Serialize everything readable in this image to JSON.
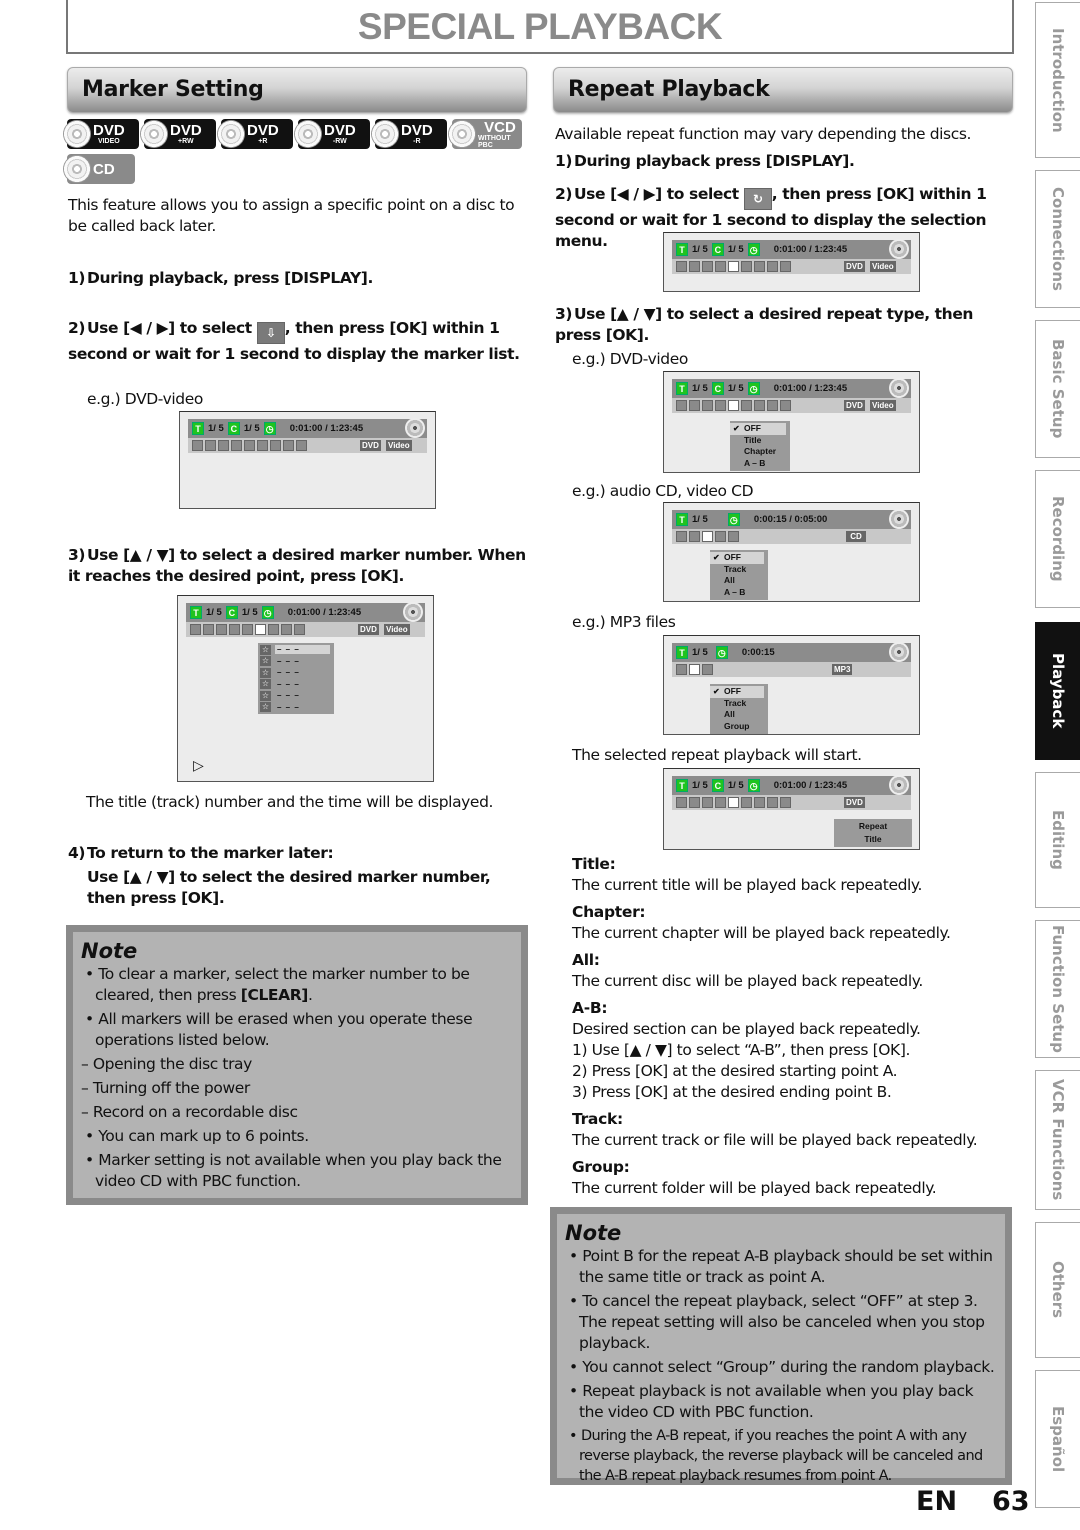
{
  "page_title": "SPECIAL PLAYBACK",
  "marker": {
    "header": "Marker Setting",
    "discs": [
      {
        "main": "DVD",
        "sub": "VIDEO",
        "style": "black"
      },
      {
        "main": "DVD",
        "sub": "+RW",
        "style": "black"
      },
      {
        "main": "DVD",
        "sub": "+R",
        "style": "black"
      },
      {
        "main": "DVD",
        "sub": "-RW",
        "style": "black"
      },
      {
        "main": "DVD",
        "sub": "-R",
        "style": "black"
      },
      {
        "main": "VCD",
        "sub": "WITHOUT PBC",
        "style": "grey"
      },
      {
        "main": "CD",
        "sub": "",
        "style": "grey"
      }
    ],
    "intro": "This feature allows you to assign a specific point on a disc to be called back later.",
    "step1_num": "1)",
    "step1": "During playback, press [DISPLAY].",
    "step2_num": "2)",
    "step2_a": "Use [◀ / ▶] to select",
    "step2_b": ", then press [OK] within 1 second or wait for 1 second to display the marker list.",
    "eg1": "e.g.) DVD-video",
    "step3_num": "3)",
    "step3": "Use [▲ / ▼] to select a desired marker number. When it reaches the desired point, press [OK].",
    "marker_rows": [
      "– – –",
      "– – –",
      "– – –",
      "– – –",
      "– – –",
      "– – –"
    ],
    "play_symbol": "▷",
    "after_text": "The title (track) number and the time will be displayed.",
    "step4_num": "4)",
    "step4_title": "To return to the marker later:",
    "step4_body": "Use [▲ / ▼] to select the desired marker number, then press [OK].",
    "note_title": "Note",
    "notes": [
      {
        "type": "bullet",
        "text": "To clear a marker, select the marker number to be cleared, then press ",
        "bold": "[CLEAR]",
        "tail": "."
      },
      {
        "type": "bullet",
        "text": "All markers will be erased when you operate these operations listed below.",
        "bold": "",
        "tail": ""
      },
      {
        "type": "dash",
        "text": "Opening the disc tray",
        "bold": "",
        "tail": ""
      },
      {
        "type": "dash",
        "text": "Turning off the power",
        "bold": "",
        "tail": ""
      },
      {
        "type": "dash",
        "text": "Record on a recordable disc",
        "bold": "",
        "tail": ""
      },
      {
        "type": "bullet",
        "text": "You can mark up to 6 points.",
        "bold": "",
        "tail": ""
      },
      {
        "type": "bullet",
        "text": "Marker setting is not available when you play back the video CD with PBC function.",
        "bold": "",
        "tail": ""
      }
    ]
  },
  "osd": {
    "title_icon": "T",
    "chapter_icon": "C",
    "title_count": "1/  5",
    "chapter_count": "1/  5",
    "time_dvd": "0:01:00 / 1:23:45",
    "time_cd": "0:00:15 / 0:05:00",
    "time_mp3": "0:00:15",
    "tag_dvd": "DVD",
    "tag_video": "Video",
    "tag_cd": "CD",
    "tag_mp3": "MP3",
    "menu_dvd": [
      "OFF",
      "Title",
      "Chapter",
      "A – B"
    ],
    "menu_cd": [
      "OFF",
      "Track",
      "All",
      "A – B"
    ],
    "menu_mp3": [
      "OFF",
      "Track",
      "All",
      "Group"
    ],
    "repeat_label": "Repeat",
    "repeat_value": "Title"
  },
  "repeat": {
    "header": "Repeat Playback",
    "intro": "Available repeat function may vary depending the discs.",
    "step1_num": "1)",
    "step1": "During playback press [DISPLAY].",
    "step2_num": "2)",
    "step2_a": "Use [◀ / ▶] to select",
    "step2_b": ", then press [OK] within 1 second or wait for 1 second to display the selection menu.",
    "step3_num": "3)",
    "step3": "Use [▲ / ▼] to select a desired repeat type, then press [OK].",
    "eg_dvd": "e.g.) DVD-video",
    "eg_cd": "e.g.) audio CD, video CD",
    "eg_mp3": "e.g.) MP3 files",
    "start_text": "The selected repeat playback will start.",
    "defs": [
      {
        "term": "Title:",
        "lines": [
          "The current title will be played back repeatedly."
        ]
      },
      {
        "term": "Chapter:",
        "lines": [
          "The current chapter will be played back repeatedly."
        ]
      },
      {
        "term": "All:",
        "lines": [
          "The current disc will be played back repeatedly."
        ]
      },
      {
        "term": "A-B:",
        "lines": [
          "Desired section can be played back repeatedly.",
          "1) Use [▲ / ▼] to select “A-B”, then press [OK].",
          "2) Press [OK] at the desired starting point A.",
          "3) Press [OK] at the desired ending point B."
        ]
      },
      {
        "term": "Track:",
        "lines": [
          "The current track or file will be played back repeatedly."
        ]
      },
      {
        "term": "Group:",
        "lines": [
          "The current folder will be played back repeatedly."
        ]
      }
    ],
    "note_title": "Note",
    "notes": [
      "Point B for the repeat A-B playback should be set within the same title or track as point A.",
      "To cancel the repeat playback, select “OFF” at step 3. The repeat setting will also be canceled when you stop playback.",
      "You cannot select “Group” during the random playback.",
      "Repeat playback is not available when you play back the video CD with PBC function.",
      "During the A-B repeat, if you reaches the point A with any reverse playback, the reverse playback will be canceled and the A-B repeat playback resumes from point A."
    ]
  },
  "side_tabs": [
    {
      "label": "Introduction",
      "active": false
    },
    {
      "label": "Connections",
      "active": false
    },
    {
      "label": "Basic Setup",
      "active": false
    },
    {
      "label": "Recording",
      "active": false
    },
    {
      "label": "Playback",
      "active": true
    },
    {
      "label": "Editing",
      "active": false
    },
    {
      "label": "Function Setup",
      "active": false
    },
    {
      "label": "VCR Functions",
      "active": false
    },
    {
      "label": "Others",
      "active": false
    },
    {
      "label": "Español",
      "active": false
    }
  ],
  "footer": {
    "lang": "EN",
    "page": "63"
  }
}
